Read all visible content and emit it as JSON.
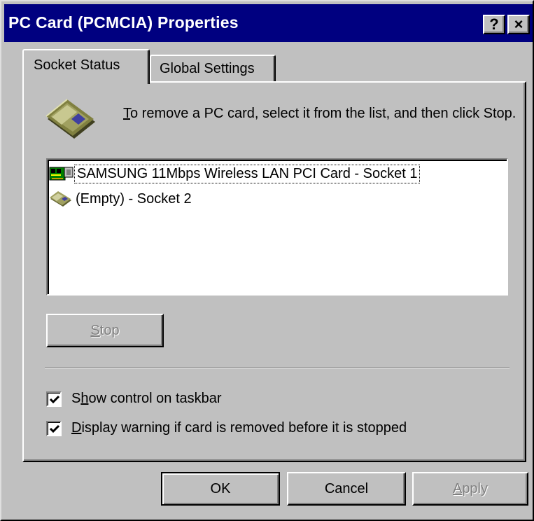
{
  "window": {
    "title": "PC Card (PCMCIA) Properties",
    "help_glyph": "?",
    "close_glyph": "×"
  },
  "tabs": [
    {
      "label": "Socket Status",
      "active": true
    },
    {
      "label": "Global Settings",
      "active": false
    }
  ],
  "instruction": {
    "mnemonic": "T",
    "rest": "o remove a PC card, select it from the list, and then click Stop."
  },
  "sockets": [
    {
      "label": "SAMSUNG 11Mbps Wireless LAN PCI Card - Socket 1",
      "icon": "network-card-icon",
      "selected": true
    },
    {
      "label": "(Empty) - Socket 2",
      "icon": "pc-card-icon",
      "selected": false
    }
  ],
  "stop_button": {
    "mnemonic": "S",
    "rest": "top",
    "enabled": false
  },
  "options": [
    {
      "pre": "S",
      "mnemonic": "h",
      "rest": "ow control on taskbar",
      "checked": true
    },
    {
      "pre": "",
      "mnemonic": "D",
      "rest": "isplay warning if card is removed before it is stopped",
      "checked": true
    }
  ],
  "buttons": {
    "ok": "OK",
    "cancel": "Cancel",
    "apply_mnemonic": "A",
    "apply_rest": "pply",
    "apply_enabled": false
  },
  "colors": {
    "titlebar": "#000080",
    "face": "#c0c0c0",
    "window_bg": "#ffffff"
  }
}
